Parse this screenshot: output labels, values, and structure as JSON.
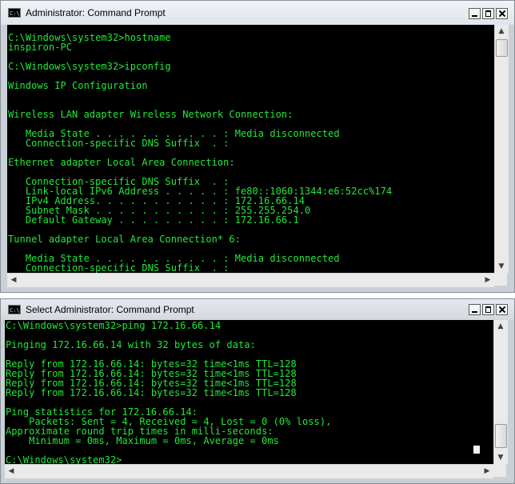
{
  "windows": [
    {
      "title": "Administrator: Command Prompt",
      "icon_text": "C:\\",
      "lines": [
        "C:\\Windows\\system32>hostname",
        "inspiron-PC",
        "",
        "C:\\Windows\\system32>ipconfig",
        "",
        "Windows IP Configuration",
        "",
        "",
        "Wireless LAN adapter Wireless Network Connection:",
        "",
        "   Media State . . . . . . . . . . . : Media disconnected",
        "   Connection-specific DNS Suffix  . :",
        "",
        "Ethernet adapter Local Area Connection:",
        "",
        "   Connection-specific DNS Suffix  . :",
        "   Link-local IPv6 Address . . . . . : fe80::1060:1344:e6:52cc%174",
        "   IPv4 Address. . . . . . . . . . . : 172.16.66.14",
        "   Subnet Mask . . . . . . . . . . . : 255.255.254.0",
        "   Default Gateway . . . . . . . . . : 172.16.66.1",
        "",
        "Tunnel adapter Local Area Connection* 6:",
        "",
        "   Media State . . . . . . . . . . . : Media disconnected",
        "   Connection-specific DNS Suffix  . :"
      ]
    },
    {
      "title": "Select Administrator: Command Prompt",
      "icon_text": "C:\\",
      "lines": [
        "C:\\Windows\\system32>ping 172.16.66.14",
        "",
        "Pinging 172.16.66.14 with 32 bytes of data:",
        "",
        "Reply from 172.16.66.14: bytes=32 time<1ms TTL=128",
        "Reply from 172.16.66.14: bytes=32 time<1ms TTL=128",
        "Reply from 172.16.66.14: bytes=32 time<1ms TTL=128",
        "Reply from 172.16.66.14: bytes=32 time<1ms TTL=128",
        "",
        "Ping statistics for 172.16.66.14:",
        "    Packets: Sent = 4, Received = 4, Lost = 0 (0% loss),",
        "Approximate round trip times in milli-seconds:",
        "    Minimum = 0ms, Maximum = 0ms, Average = 0ms",
        "",
        "C:\\Windows\\system32>_"
      ]
    }
  ],
  "scroll_arrows": {
    "up": "▲",
    "down": "▼",
    "left": "◀",
    "right": "▶"
  },
  "colors": {
    "console_bg": "#000000",
    "console_text": "#22e838",
    "chrome": "#c9d0d8"
  }
}
